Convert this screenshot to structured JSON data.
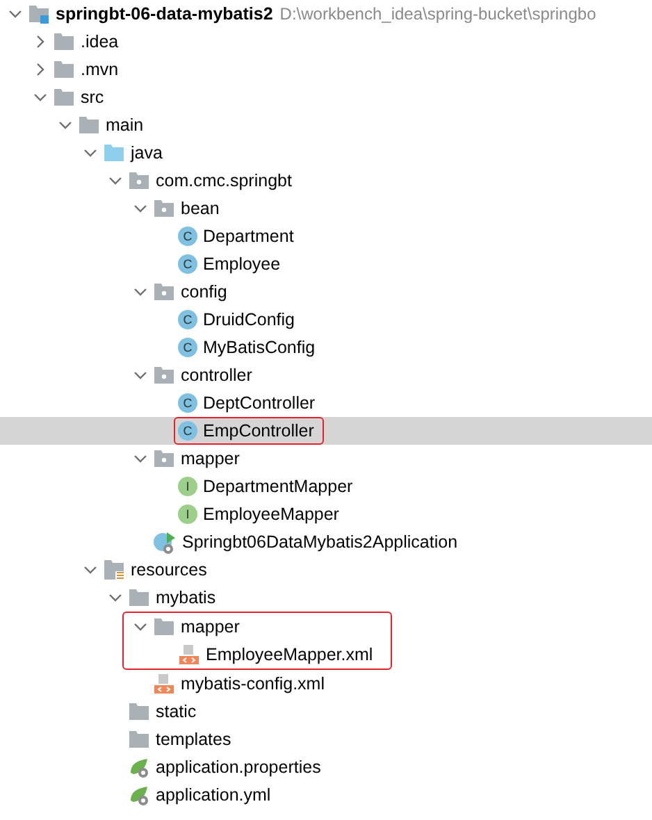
{
  "tree": [
    {
      "label": "springbt-06-data-mybatis2",
      "kind": "module",
      "path": "D:\\workbench_idea\\spring-bucket\\springbo",
      "expanded": true,
      "selected": false,
      "children": [
        {
          "label": ".idea",
          "kind": "folder",
          "expanded": false,
          "selected": false
        },
        {
          "label": ".mvn",
          "kind": "folder",
          "expanded": false,
          "selected": false
        },
        {
          "label": "src",
          "kind": "folder",
          "expanded": true,
          "selected": false,
          "children": [
            {
              "label": "main",
              "kind": "folder",
              "expanded": true,
              "selected": false,
              "children": [
                {
                  "label": "java",
                  "kind": "source",
                  "expanded": true,
                  "selected": false,
                  "children": [
                    {
                      "label": "com.cmc.springbt",
                      "kind": "package",
                      "expanded": true,
                      "selected": false,
                      "children": [
                        {
                          "label": "bean",
                          "kind": "package",
                          "expanded": true,
                          "selected": false,
                          "children": [
                            {
                              "label": "Department",
                              "kind": "class",
                              "badge": "C",
                              "selected": false
                            },
                            {
                              "label": "Employee",
                              "kind": "class",
                              "badge": "C",
                              "selected": false
                            }
                          ]
                        },
                        {
                          "label": "config",
                          "kind": "package",
                          "expanded": true,
                          "selected": false,
                          "children": [
                            {
                              "label": "DruidConfig",
                              "kind": "class",
                              "badge": "C",
                              "selected": false
                            },
                            {
                              "label": "MyBatisConfig",
                              "kind": "class",
                              "badge": "C",
                              "selected": false
                            }
                          ]
                        },
                        {
                          "label": "controller",
                          "kind": "package",
                          "expanded": true,
                          "selected": false,
                          "children": [
                            {
                              "label": "DeptController",
                              "kind": "class",
                              "badge": "C",
                              "selected": false
                            },
                            {
                              "label": "EmpController",
                              "kind": "class",
                              "badge": "C",
                              "selected": true,
                              "framed": true
                            }
                          ]
                        },
                        {
                          "label": "mapper",
                          "kind": "package",
                          "expanded": true,
                          "selected": false,
                          "children": [
                            {
                              "label": "DepartmentMapper",
                              "kind": "interface",
                              "badge": "I",
                              "selected": false
                            },
                            {
                              "label": "EmployeeMapper",
                              "kind": "interface",
                              "badge": "I",
                              "selected": false
                            }
                          ]
                        },
                        {
                          "label": "Springbt06DataMybatis2Application",
                          "kind": "app",
                          "selected": false
                        }
                      ]
                    }
                  ]
                },
                {
                  "label": "resources",
                  "kind": "resources",
                  "expanded": true,
                  "selected": false,
                  "children": [
                    {
                      "label": "mybatis",
                      "kind": "folder",
                      "expanded": true,
                      "selected": false,
                      "children": [
                        {
                          "label": "mapper",
                          "kind": "folder",
                          "expanded": true,
                          "selected": false,
                          "framed": true,
                          "children": [
                            {
                              "label": "EmployeeMapper.xml",
                              "kind": "xml",
                              "selected": false
                            }
                          ]
                        },
                        {
                          "label": "mybatis-config.xml",
                          "kind": "xml",
                          "selected": false
                        }
                      ]
                    },
                    {
                      "label": "static",
                      "kind": "folder",
                      "selected": false
                    },
                    {
                      "label": "templates",
                      "kind": "folder",
                      "selected": false
                    },
                    {
                      "label": "application.properties",
                      "kind": "spring",
                      "selected": false
                    },
                    {
                      "label": "application.yml",
                      "kind": "spring",
                      "selected": false
                    }
                  ]
                }
              ]
            }
          ]
        }
      ]
    }
  ]
}
